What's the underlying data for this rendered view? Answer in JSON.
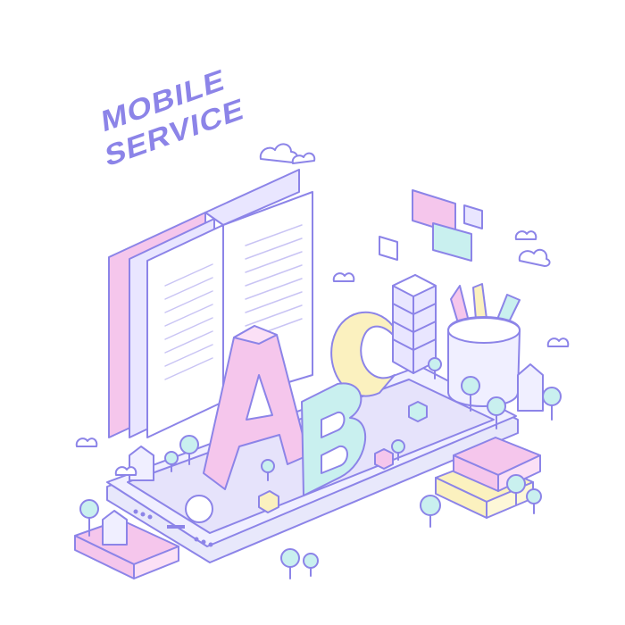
{
  "headline": {
    "line1": "MOBILE",
    "line2": "SERVICE"
  },
  "scene": {
    "letters": [
      "A",
      "B",
      "C"
    ],
    "icons": [
      "cloud-icon",
      "house-icon",
      "tree-icon",
      "book-icon",
      "pencil-cup-icon",
      "building-icon",
      "smartphone-icon",
      "cube-icon"
    ]
  },
  "colors": {
    "outline": "#8c84e8",
    "phone": "#e8e8fb",
    "pink": "#f5c6ec",
    "mint": "#c9f0ef",
    "yellow": "#fbf1bf",
    "lavender": "#e9e6ff"
  }
}
